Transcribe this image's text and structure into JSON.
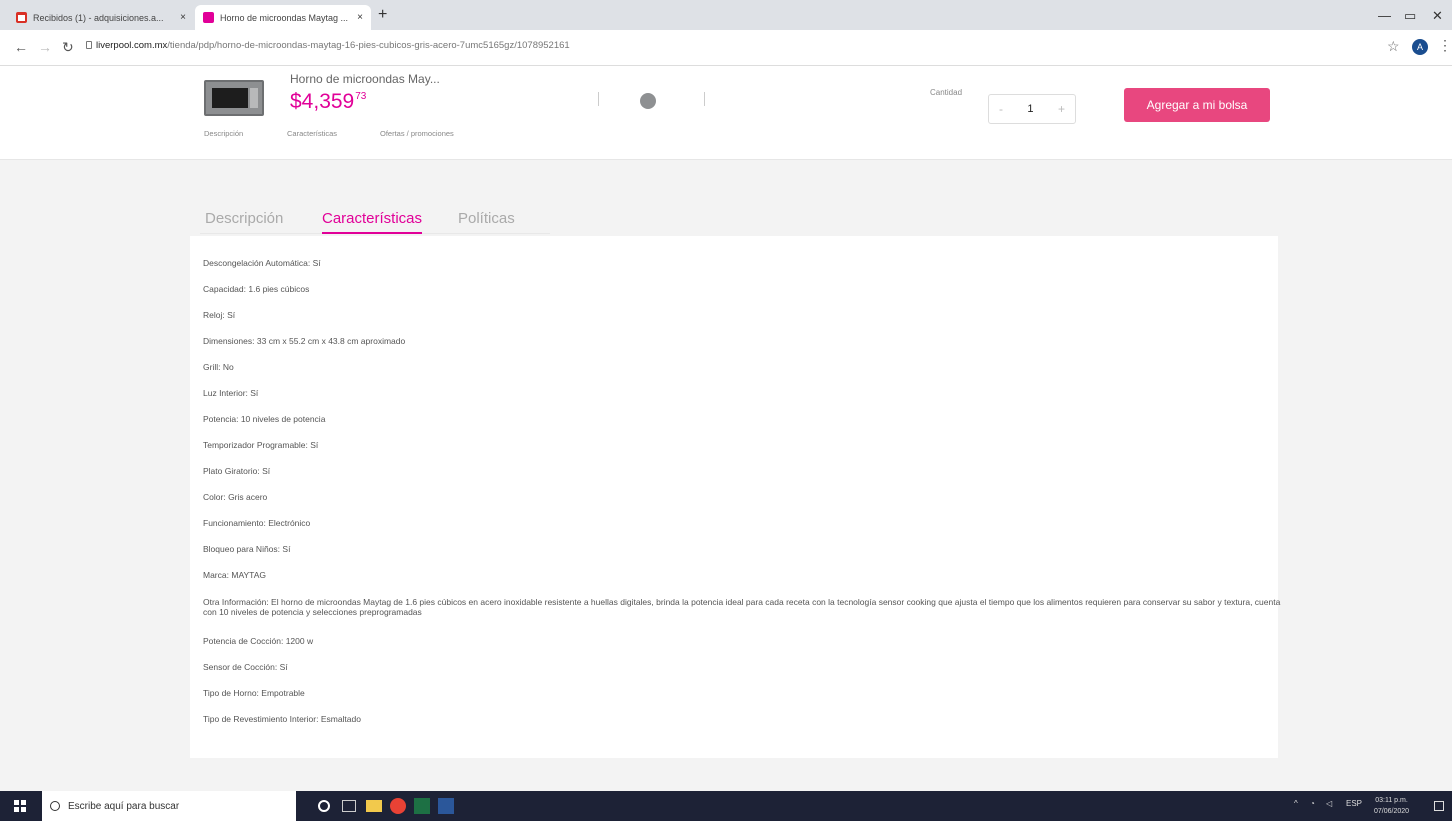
{
  "browser": {
    "tabs": [
      {
        "title": "Recibidos (1) - adquisiciones.a...",
        "close": "×"
      },
      {
        "title": "Horno de microondas Maytag ...",
        "close": "×"
      }
    ],
    "new_tab": "+",
    "url_host": "liverpool.com.mx",
    "url_path": "/tienda/pdp/horno-de-microondas-maytag-16-pies-cubicos-gris-acero-7umc5165gz/1078952161",
    "avatar": "A"
  },
  "product_bar": {
    "name": "Horno de microondas May...",
    "price_main": "$4,359",
    "price_cents": "73",
    "nav": [
      "Descripción",
      "Características",
      "Ofertas / promociones"
    ],
    "quantity_label": "Cantidad",
    "quantity_minus": "-",
    "quantity_value": "1",
    "quantity_plus": "+",
    "add_button": "Agregar a mi bolsa"
  },
  "content_tabs": [
    "Descripción",
    "Características",
    "Políticas"
  ],
  "specs": [
    {
      "label": "Descongelación Automática:",
      "value": "Sí"
    },
    {
      "label": "Capacidad:",
      "value": "1.6 pies cúbicos"
    },
    {
      "label": "Reloj:",
      "value": "Sí"
    },
    {
      "label": "Dimensiones:",
      "value": "33 cm x 55.2 cm x 43.8 cm aproximado"
    },
    {
      "label": "Grill:",
      "value": "No"
    },
    {
      "label": "Luz Interior:",
      "value": "Sí"
    },
    {
      "label": "Potencia:",
      "value": "10 niveles de potencia"
    },
    {
      "label": "Temporizador Programable:",
      "value": "Sí"
    },
    {
      "label": "Plato Giratorio:",
      "value": "Sí"
    },
    {
      "label": "Color:",
      "value": "Gris acero"
    },
    {
      "label": "Funcionamiento:",
      "value": "Electrónico"
    },
    {
      "label": "Bloqueo para Niños:",
      "value": "Sí"
    },
    {
      "label": "Marca:",
      "value": "MAYTAG"
    },
    {
      "label": "Otra Información:",
      "value": "El horno de microondas Maytag de 1.6 pies cúbicos en acero inoxidable resistente a huellas digitales, brinda la potencia ideal para cada receta con la tecnología sensor cooking que ajusta el tiempo que los alimentos requieren para conservar su sabor y textura, cuenta con 10 niveles de potencia y selecciones preprogramadas"
    },
    {
      "label": "Potencia de Cocción:",
      "value": "1200 w"
    },
    {
      "label": "Sensor de Cocción:",
      "value": "Sí"
    },
    {
      "label": "Tipo de Horno:",
      "value": "Empotrable"
    },
    {
      "label": "Tipo de Revestimiento Interior:",
      "value": "Esmaltado"
    }
  ],
  "taskbar": {
    "search_placeholder": "Escribe aquí para buscar",
    "language": "ESP",
    "time": "03:11 p.m.",
    "date": "07/06/2020"
  },
  "colors": {
    "brand": "#e10098",
    "button": "#e8477f"
  }
}
